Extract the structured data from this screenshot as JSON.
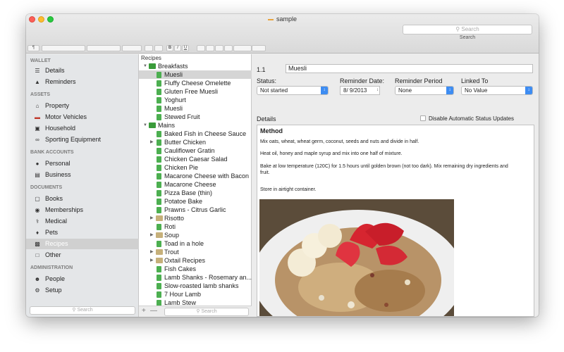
{
  "window": {
    "title": "sample",
    "search_placeholder": "Search",
    "search_caption": "Search"
  },
  "format_bar": {
    "paragraph": "¶",
    "bold": "B",
    "italic": "I",
    "underline": "U"
  },
  "sidebar": {
    "sections": [
      {
        "header": "WALLET",
        "items": [
          {
            "label": "Details",
            "icon": "list-icon"
          },
          {
            "label": "Reminders",
            "icon": "bell-icon"
          }
        ]
      },
      {
        "header": "ASSETS",
        "items": [
          {
            "label": "Property",
            "icon": "house-icon"
          },
          {
            "label": "Motor Vehicles",
            "icon": "car-icon"
          },
          {
            "label": "Household",
            "icon": "tv-icon"
          },
          {
            "label": "Sporting Equipment",
            "icon": "bicycle-icon"
          }
        ]
      },
      {
        "header": "BANK ACCOUNTS",
        "items": [
          {
            "label": "Personal",
            "icon": "piggy-bank-icon"
          },
          {
            "label": "Business",
            "icon": "bank-icon"
          }
        ]
      },
      {
        "header": "DOCUMENTS",
        "items": [
          {
            "label": "Books",
            "icon": "book-icon"
          },
          {
            "label": "Memberships",
            "icon": "badge-icon"
          },
          {
            "label": "Medical",
            "icon": "caduceus-icon"
          },
          {
            "label": "Pets",
            "icon": "dog-icon"
          },
          {
            "label": "Recipes",
            "icon": "recipe-icon"
          },
          {
            "label": "Other",
            "icon": "box-icon"
          }
        ]
      },
      {
        "header": "ADMINISTRATION",
        "items": [
          {
            "label": "People",
            "icon": "people-icon"
          },
          {
            "label": "Setup",
            "icon": "gear-icon"
          }
        ]
      }
    ],
    "selected": "Recipes",
    "search_placeholder": "Search"
  },
  "recipes": {
    "header": "Recipes",
    "tree": [
      {
        "label": "Breakfasts",
        "kind": "folder-open",
        "level": 0
      },
      {
        "label": "Muesli",
        "kind": "page",
        "level": 1,
        "selected": true
      },
      {
        "label": "Fluffy Cheese Omelette",
        "kind": "page",
        "level": 1
      },
      {
        "label": "Gluten Free Muesli",
        "kind": "page",
        "level": 1
      },
      {
        "label": "Yoghurt",
        "kind": "page",
        "level": 1
      },
      {
        "label": "Muesli",
        "kind": "page",
        "level": 1
      },
      {
        "label": "Stewed Fruit",
        "kind": "page",
        "level": 1
      },
      {
        "label": "Mains",
        "kind": "folder-open",
        "level": 0
      },
      {
        "label": "Baked Fish in Cheese Sauce",
        "kind": "page",
        "level": 1
      },
      {
        "label": "Butter Chicken",
        "kind": "page-collapsed",
        "level": 1
      },
      {
        "label": "Cauliflower Gratin",
        "kind": "page",
        "level": 1
      },
      {
        "label": "Chicken Caesar Salad",
        "kind": "page",
        "level": 1
      },
      {
        "label": "Chicken Pie",
        "kind": "page",
        "level": 1
      },
      {
        "label": "Macarone Cheese with Bacon",
        "kind": "page",
        "level": 1
      },
      {
        "label": "Macarone Cheese",
        "kind": "page",
        "level": 1
      },
      {
        "label": "Pizza Base (thin)",
        "kind": "page",
        "level": 1
      },
      {
        "label": "Potatoe Bake",
        "kind": "page",
        "level": 1
      },
      {
        "label": "Prawns - Citrus Garlic",
        "kind": "page",
        "level": 1
      },
      {
        "label": "Risotto",
        "kind": "folder-closed",
        "level": 1
      },
      {
        "label": "Roti",
        "kind": "page",
        "level": 1
      },
      {
        "label": "Soup",
        "kind": "folder-closed",
        "level": 1
      },
      {
        "label": "Toad in a hole",
        "kind": "page",
        "level": 1
      },
      {
        "label": "Trout",
        "kind": "folder-closed",
        "level": 1
      },
      {
        "label": "Oxtail Recipes",
        "kind": "folder-closed",
        "level": 1
      },
      {
        "label": "Fish Cakes",
        "kind": "page",
        "level": 1
      },
      {
        "label": "Lamb Shanks - Rosemary an...",
        "kind": "page",
        "level": 1
      },
      {
        "label": "Slow-roasted lamb shanks",
        "kind": "page",
        "level": 1
      },
      {
        "label": "7 Hour Lamb",
        "kind": "page",
        "level": 1
      },
      {
        "label": "Lamb Stew",
        "kind": "page",
        "level": 1
      }
    ],
    "add_label": "+",
    "remove_label": "—",
    "search_placeholder": "Search"
  },
  "detail": {
    "number": "1.1",
    "name": "Muesli",
    "status_label": "Status:",
    "status_value": "Not started",
    "reminder_date_label": "Reminder Date:",
    "reminder_date_value": "8/ 9/2013",
    "reminder_period_label": "Reminder Period",
    "reminder_period_value": "None",
    "linked_to_label": "Linked To",
    "linked_to_value": "No Value",
    "details_label": "Details",
    "disable_auto_label": "Disable Automatic Status Updates",
    "method_heading": "Method",
    "paragraphs": [
      "Mix oats, wheat, wheat germ, coconut, seeds and nuts and divide in half.",
      "Heat oil, honey and maple syrup and mix into one half of mixture.",
      "Bake at low temperature (120C) for 1.5 hours until golden brown (not too dark).  Mix remaining dry ingredients and fruit.",
      "Store in airtight container."
    ]
  }
}
